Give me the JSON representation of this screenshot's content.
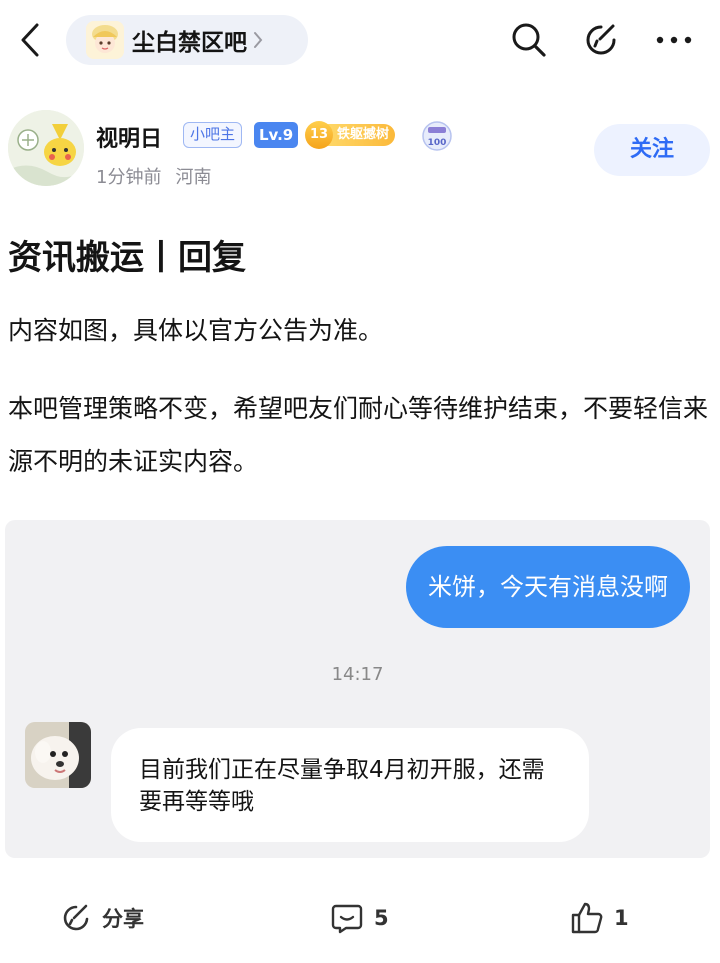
{
  "forum": {
    "name": "尘白禁区吧"
  },
  "author": {
    "name": "视明日",
    "badge_role": "小吧主",
    "badge_level": "Lv.9",
    "title_level": "13",
    "title_name": "铁躯撼树",
    "calendar_badge": "100",
    "time": "1分钟前",
    "location": "河南",
    "follow_label": "关注"
  },
  "post": {
    "title": "资讯搬运丨回复",
    "paragraph1": "内容如图，具体以官方公告为准。",
    "paragraph2": "本吧管理策略不变，希望吧友们耐心等待维护结束，不要轻信来源不明的未证实内容。"
  },
  "chat": {
    "outgoing": "米饼，今天有消息没啊",
    "time": "14:17",
    "incoming": "目前我们正在尽量争取4月初开服，还需要再等等哦"
  },
  "actions": {
    "share_label": "分享",
    "comment_count": "5",
    "like_count": "1"
  },
  "colors": {
    "accent": "#2e6bf5",
    "bubble": "#3b8ef3",
    "title_badge": "#fbb93a"
  }
}
